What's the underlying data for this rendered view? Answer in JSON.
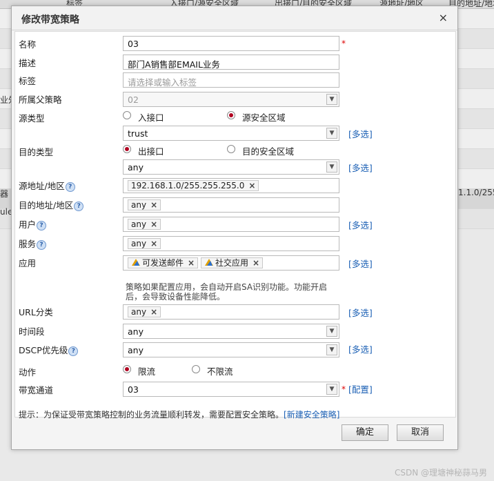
{
  "background": {
    "headers": [
      "标签",
      "入接口/源安全区域",
      "出接口/目的安全区域",
      "源地址/地区",
      "目的地址/地址"
    ],
    "cells": [
      "业外",
      "器",
      "1.1.0/255",
      "ule"
    ]
  },
  "dialog": {
    "title": "修改带宽策略",
    "close": "×",
    "fields": {
      "name": {
        "label": "名称",
        "value": "03",
        "required": "*"
      },
      "desc": {
        "label": "描述",
        "value": "部门A销售部EMAIL业务"
      },
      "tags": {
        "label": "标签",
        "placeholder": "请选择或输入标签"
      },
      "parent": {
        "label": "所属父策略",
        "value": "02"
      },
      "src_type": {
        "label": "源类型",
        "opt1": "入接口",
        "opt2": "源安全区域"
      },
      "src_value": {
        "value": "trust",
        "more": "[多选]"
      },
      "dst_type": {
        "label": "目的类型",
        "opt1": "出接口",
        "opt2": "目的安全区域"
      },
      "dst_value": {
        "value": "any",
        "more": "[多选]"
      },
      "src_addr": {
        "label": "源地址/地区",
        "tag": "192.168.1.0/255.255.255.0"
      },
      "dst_addr": {
        "label": "目的地址/地区",
        "tag": "any"
      },
      "user": {
        "label": "用户",
        "tag": "any",
        "more": "[多选]"
      },
      "service": {
        "label": "服务",
        "tag": "any"
      },
      "app": {
        "label": "应用",
        "tag1": "可发送邮件",
        "tag2": "社交应用",
        "more": "[多选]"
      },
      "app_note": "策略如果配置应用，会自动开启SA识别功能。功能开启后，会导致设备性能降低。",
      "url": {
        "label": "URL分类",
        "tag": "any",
        "more": "[多选]"
      },
      "time": {
        "label": "时间段",
        "value": "any"
      },
      "dscp": {
        "label": "DSCP优先级",
        "value": "any",
        "more": "[多选]"
      },
      "action": {
        "label": "动作",
        "opt1": "限流",
        "opt2": "不限流"
      },
      "channel": {
        "label": "带宽通道",
        "value": "03",
        "required": "*",
        "config": "[配置]"
      }
    },
    "tip_text": "提示：为保证受带宽策略控制的业务流量顺利转发，需要配置安全策略。",
    "tip_link": "[新建安全策略]",
    "ok": "确定",
    "cancel": "取消"
  },
  "watermark": "CSDN @理塘神秘蒜马男",
  "colors": {
    "accent_link": "#1a5fb4",
    "radio_on": "#b00020",
    "required": "#dd0000"
  }
}
